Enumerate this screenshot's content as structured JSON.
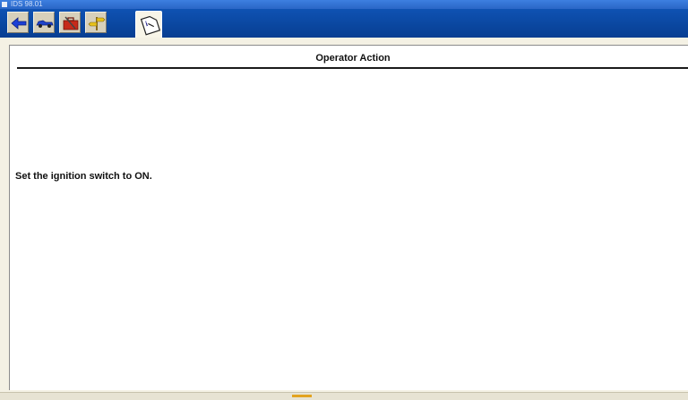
{
  "window": {
    "title": "IDS 98.01"
  },
  "toolbar": {
    "buttons": [
      {
        "icon": "back-arrow-icon"
      },
      {
        "icon": "vehicle-icon"
      },
      {
        "icon": "toolbox-icon"
      },
      {
        "icon": "signpost-icon"
      }
    ],
    "active_tab_icon": "info-document-icon"
  },
  "panel": {
    "header": "Operator Action",
    "instruction": "Set the ignition switch to ON."
  },
  "colors": {
    "toolbar_blue": "#0a4aa6",
    "frame_beige": "#f4f1e4",
    "status_orange": "#e2a31f"
  }
}
